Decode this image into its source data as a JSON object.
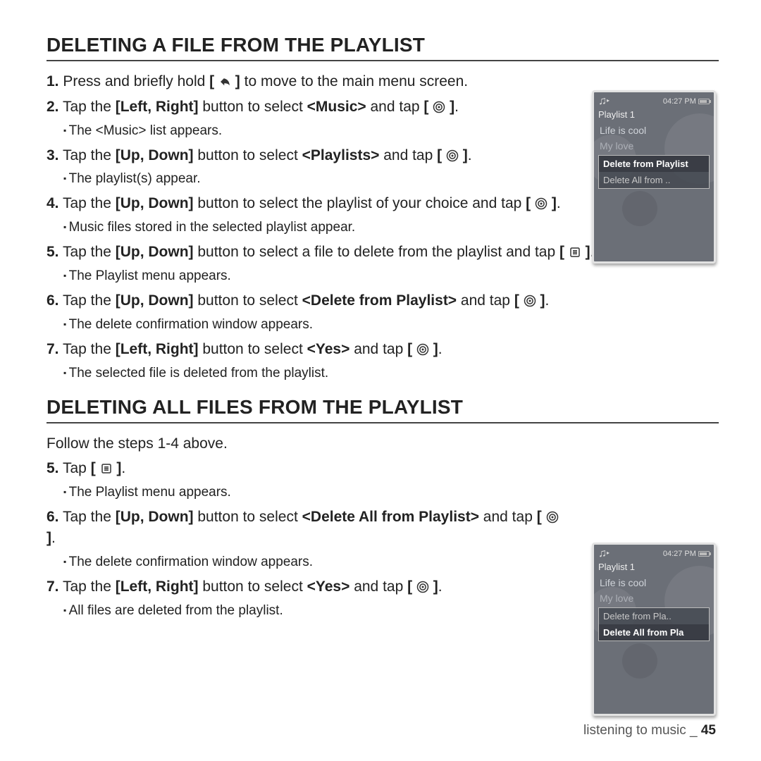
{
  "section1": {
    "heading": "DELETING A FILE FROM THE PLAYLIST",
    "step1_a": "Press and briefly hold ",
    "step1_b": " to move to the main menu screen.",
    "step2_a": "Tap the ",
    "step2_nav1": "[Left, Right]",
    "step2_b": " button to select ",
    "step2_tgt": "<Music>",
    "step2_c": " and tap ",
    "sub2": "The <Music> list appears.",
    "step3_a": "Tap the ",
    "step3_nav": "[Up, Down]",
    "step3_b": " button to select ",
    "step3_tgt": "<Playlists>",
    "step3_c": " and tap ",
    "sub3": "The playlist(s) appear.",
    "step4_a": "Tap the ",
    "step4_nav": "[Up, Down]",
    "step4_b": " button to select the playlist of your choice and tap ",
    "sub4": "Music files stored in the selected playlist appear.",
    "step5_a": "Tap the ",
    "step5_nav": "[Up, Down]",
    "step5_b": " button to select a file to delete from the playlist and tap ",
    "sub5": "The Playlist menu appears.",
    "step6_a": "Tap the ",
    "step6_nav": "[Up, Down]",
    "step6_b": " button to select ",
    "step6_tgt": "<Delete from Playlist>",
    "step6_c": " and tap ",
    "sub6": "The delete confirmation window appears.",
    "step7_a": "Tap the ",
    "step7_nav": "[Left, Right]",
    "step7_b": " button to select ",
    "step7_tgt": "<Yes>",
    "step7_c": " and tap ",
    "sub7": "The selected file is deleted from the playlist."
  },
  "section2": {
    "heading": "DELETING ALL FILES FROM THE PLAYLIST",
    "intro": "Follow the steps 1-4 above.",
    "step5": "Tap ",
    "sub5": "The Playlist menu appears.",
    "step6_a": "Tap the ",
    "step6_nav": "[Up, Down]",
    "step6_b": " button to select ",
    "step6_tgt": "<Delete All from Playlist>",
    "step6_c": " and tap ",
    "sub6": "The delete confirmation window appears.",
    "step7_a": "Tap the ",
    "step7_nav": "[Left, Right]",
    "step7_b": " button to select ",
    "step7_tgt": "<Yes>",
    "step7_c": " and tap ",
    "sub7": "All files are deleted from the playlist."
  },
  "device": {
    "time": "04:27 PM",
    "title": "Playlist 1",
    "song1": "Life is cool",
    "song2": "My love",
    "menu1_row1": "Delete from Playlist",
    "menu1_row2": "Delete All from ..",
    "menu2_row1": "Delete from Pla..",
    "menu2_row2": "Delete All from Pla"
  },
  "footer": {
    "text": "listening to music _ ",
    "page": "45"
  },
  "steps": {
    "n1": "1.",
    "n2": "2.",
    "n3": "3.",
    "n4": "4.",
    "n5": "5.",
    "n6": "6.",
    "n7": "7."
  },
  "period": "."
}
